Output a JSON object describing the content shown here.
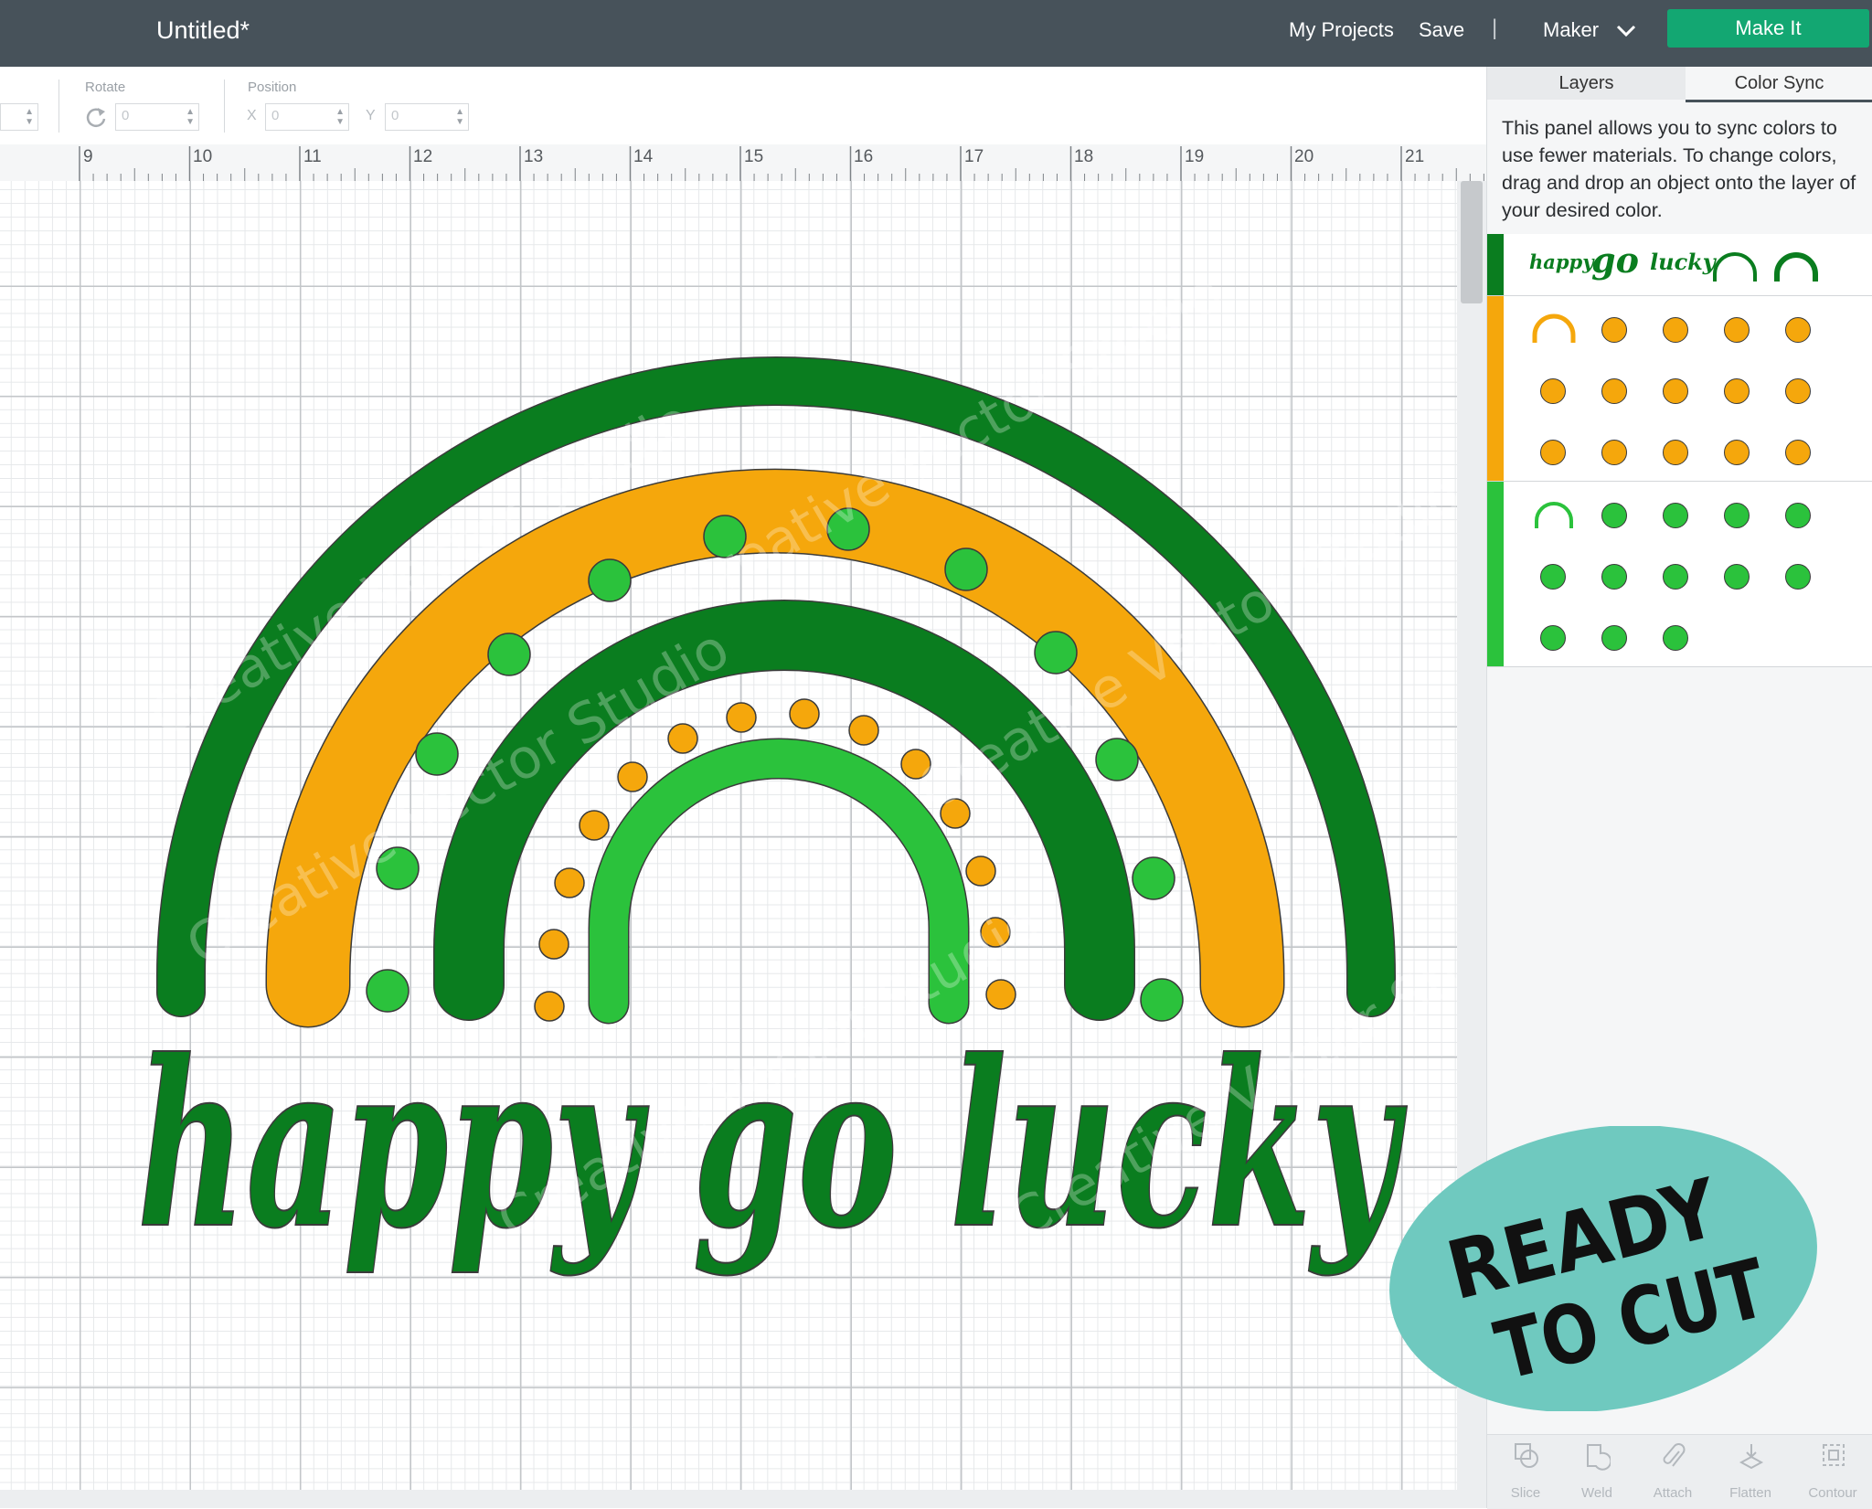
{
  "app": {
    "title": "Untitled*",
    "nav": {
      "my_projects": "My Projects",
      "save": "Save",
      "separator": "|",
      "maker": "Maker",
      "make_it": "Make It"
    },
    "accent_color": "#13a772",
    "header_color": "#47525a"
  },
  "toolbar": {
    "rotate_label": "Rotate",
    "rotate_value": "0",
    "position_label": "Position",
    "x_label": "X",
    "x_value": "0",
    "y_label": "Y",
    "y_value": "0",
    "rotate_icon": "rotate-icon"
  },
  "ruler": {
    "labels": [
      "9",
      "10",
      "11",
      "12",
      "13",
      "14",
      "15",
      "16",
      "17",
      "18",
      "19",
      "20",
      "21"
    ]
  },
  "canvas": {
    "design_text": "happy go lucky",
    "watermark": "Creative Vector Studio",
    "colors": {
      "dark_green": "#0a7d1f",
      "orange": "#f5a70c",
      "light_green": "#2bc23c"
    }
  },
  "panel": {
    "tabs": {
      "layers": "Layers",
      "color_sync": "Color Sync"
    },
    "description": "This panel allows you to sync colors to use fewer materials. To change colors, drag and drop an object onto the layer of your desired color.",
    "group_dark": {
      "words": [
        "happy",
        "go",
        "lucky"
      ],
      "color": "#0a7d1f"
    },
    "group_orange": {
      "color": "#f5a70c",
      "dot_count": 14
    },
    "group_green": {
      "color": "#2bc23c",
      "dot_count": 12
    },
    "tools": {
      "slice": "Slice",
      "weld": "Weld",
      "attach": "Attach",
      "flatten": "Flatten",
      "contour": "Contour"
    }
  },
  "badge": {
    "line1": "READY",
    "line2": "TO CUT",
    "color": "#6fc9bf"
  }
}
